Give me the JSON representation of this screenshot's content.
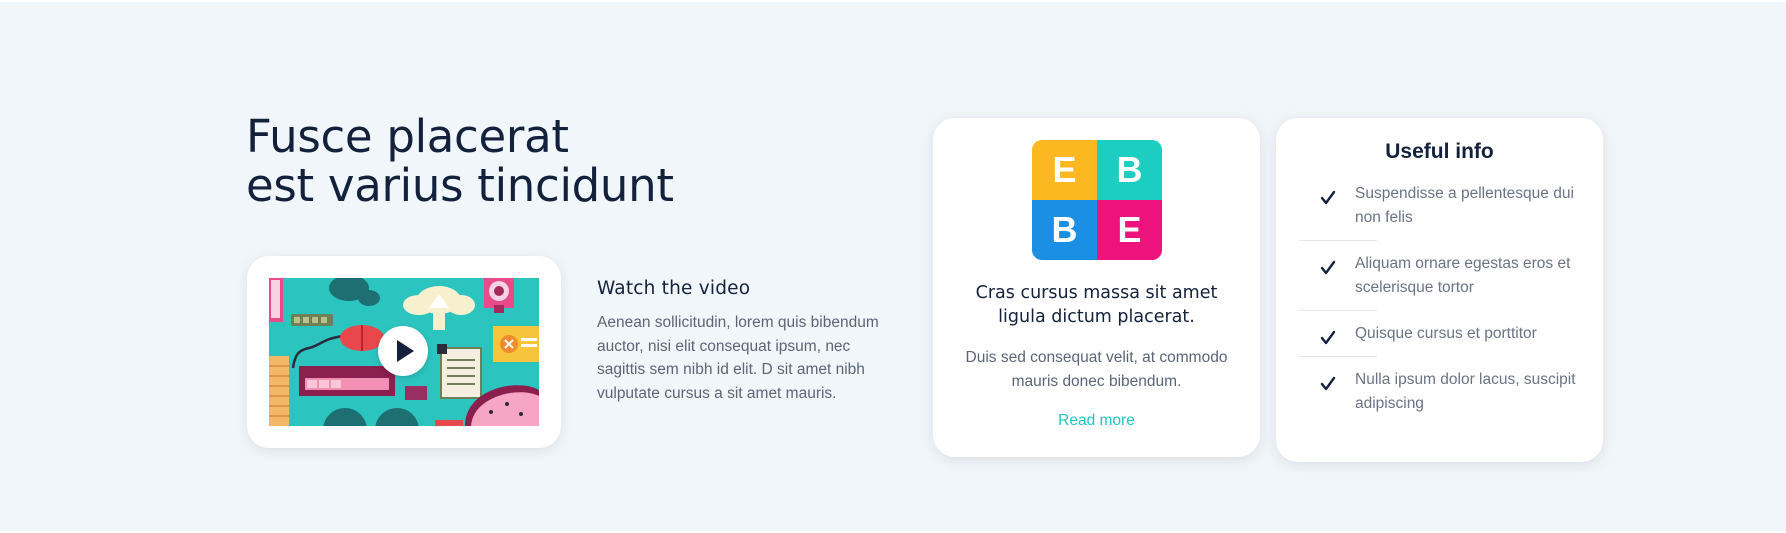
{
  "hero": {
    "headline_line1": "Fusce placerat",
    "headline_line2": "est varius tincidunt"
  },
  "video": {
    "title": "Watch the video",
    "description": "Aenean sollicitudin, lorem quis bibendum auctor, nisi elit consequat ipsum, nec sagittis sem nibh id elit. D sit amet nibh vulputate cursus a sit amet mauris.",
    "play_icon": "play-icon"
  },
  "feature_card": {
    "logo_letters": [
      "E",
      "B",
      "B",
      "E"
    ],
    "logo_colors": [
      "#fbb820",
      "#1ccdc1",
      "#1a8fe3",
      "#ec137d"
    ],
    "title": "Cras cursus massa sit amet ligula dictum placerat.",
    "description": "Duis sed consequat velit, at commodo mauris donec bibendum.",
    "link_label": "Read more"
  },
  "info_card": {
    "title": "Useful info",
    "items": [
      {
        "text": "Suspendisse a pellentesque dui non felis"
      },
      {
        "text": "Aliquam ornare egestas eros et scelerisque tortor"
      },
      {
        "text": "Quisque cursus et porttitor"
      },
      {
        "text": "Nulla ipsum dolor lacus, suscipit adipiscing"
      }
    ],
    "icon": "check-icon"
  },
  "colors": {
    "background": "#f1f6fa",
    "heading": "#14213d",
    "body_text": "#5c6577",
    "accent": "#1cc7c1"
  }
}
